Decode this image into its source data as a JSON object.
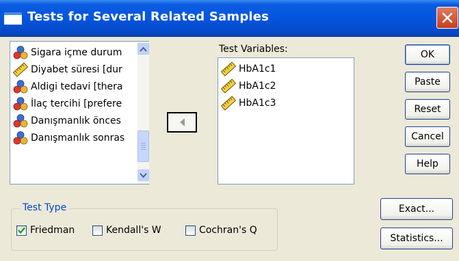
{
  "window": {
    "title": "Tests for Several Related Samples"
  },
  "source_list": {
    "items": [
      {
        "label": "Sigara içme durum",
        "icon": "nominal-variable-icon"
      },
      {
        "label": "Diyabet süresi [dur",
        "icon": "scale-variable-icon"
      },
      {
        "label": "Aldigi tedavi [thera",
        "icon": "nominal-variable-icon"
      },
      {
        "label": "İlaç tercihi [prefere",
        "icon": "nominal-variable-icon"
      },
      {
        "label": "Danışmanlık önces",
        "icon": "nominal-variable-icon"
      },
      {
        "label": "Danışmanlık sonras",
        "icon": "nominal-variable-icon"
      }
    ]
  },
  "test_variables": {
    "label": "Test Variables:",
    "items": [
      {
        "label": "HbA1c1",
        "icon": "scale-variable-icon"
      },
      {
        "label": "HbA1c2",
        "icon": "scale-variable-icon"
      },
      {
        "label": "HbA1c3",
        "icon": "scale-variable-icon"
      }
    ]
  },
  "buttons": {
    "ok": "OK",
    "paste": "Paste",
    "reset": "Reset",
    "cancel": "Cancel",
    "help": "Help",
    "exact": "Exact...",
    "statistics": "Statistics..."
  },
  "test_type": {
    "title": "Test Type",
    "options": [
      {
        "label": "Friedman",
        "checked": true
      },
      {
        "label": "Kendall's W",
        "checked": false
      },
      {
        "label": "Cochran's Q",
        "checked": false
      }
    ]
  },
  "colors": {
    "titlebar": "#0555E0",
    "dialog_bg": "#ECE9D8",
    "group_title": "#0046D5",
    "checkmark": "#21A121"
  }
}
